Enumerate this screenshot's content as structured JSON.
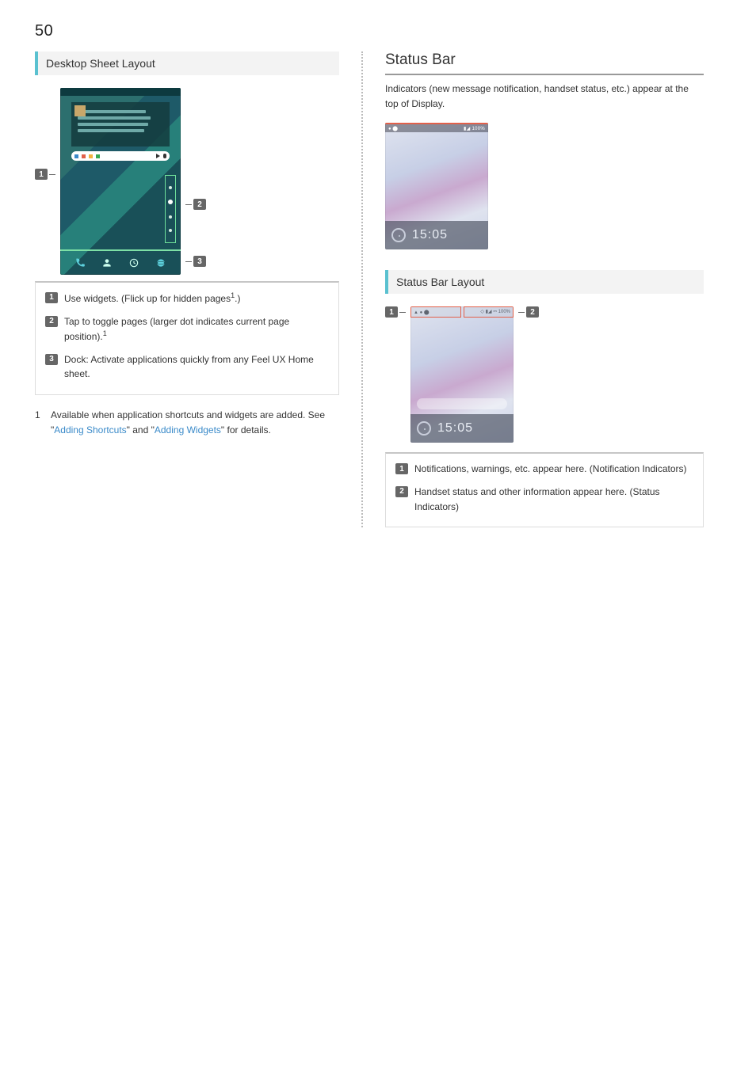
{
  "page_number": "50",
  "left": {
    "heading": "Desktop Sheet Layout",
    "figure": {
      "labels": {
        "one": "1",
        "two": "2",
        "three": "3"
      },
      "dock_icons": [
        "phone",
        "contact",
        "clock",
        "browser"
      ]
    },
    "callouts": [
      {
        "num": "1",
        "text_pre": "Use widgets. (Flick up for hidden pages",
        "sup": "1",
        "text_post": ".)"
      },
      {
        "num": "2",
        "text_pre": "Tap to toggle pages (larger dot indicates current page position).",
        "sup": "1",
        "text_post": ""
      },
      {
        "num": "3",
        "text_pre": "Dock: Activate applications quickly from any Feel UX Home sheet.",
        "sup": "",
        "text_post": ""
      }
    ],
    "footnote": {
      "mark": "1",
      "pre": "Available when application shortcuts and widgets are added. See \"",
      "link1": "Adding Shortcuts",
      "mid": "\" and \"",
      "link2": "Adding Widgets",
      "post": "\" for details."
    }
  },
  "right": {
    "heading": "Status Bar",
    "intro": "Indicators (new message notification, handset status, etc.) appear at the top of Display.",
    "fig1": {
      "sbar_left": "● ⬤",
      "sbar_right": "▮◢ 100%",
      "time": "15:05"
    },
    "sub_heading": "Status Bar Layout",
    "fig2": {
      "labels": {
        "one": "1",
        "two": "2"
      },
      "left_icons": "▲ ● ⬤",
      "right_icons": "◇ ▮◢ ⎓ 100%",
      "time": "15:05"
    },
    "callouts": [
      {
        "num": "1",
        "text": "Notifications, warnings, etc. appear here. (Notification Indicators)"
      },
      {
        "num": "2",
        "text": "Handset status and other information appear here. (Status Indicators)"
      }
    ]
  }
}
